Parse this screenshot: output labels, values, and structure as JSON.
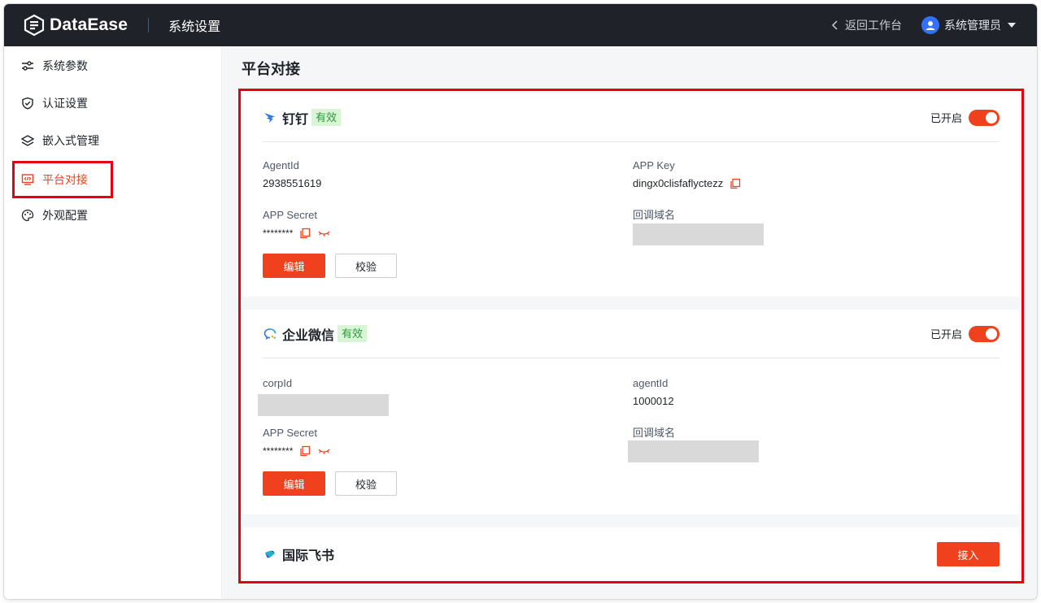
{
  "app": {
    "name": "DataEase",
    "section": "系统设置"
  },
  "header": {
    "back_label": "返回工作台",
    "user_name": "系统管理员"
  },
  "sidebar": {
    "items": [
      {
        "label": "系统参数",
        "icon": "sliders-icon"
      },
      {
        "label": "认证设置",
        "icon": "shield-icon"
      },
      {
        "label": "嵌入式管理",
        "icon": "layers-icon"
      },
      {
        "label": "平台对接",
        "icon": "monitor-code-icon",
        "active": true
      },
      {
        "label": "外观配置",
        "icon": "palette-icon"
      }
    ]
  },
  "page": {
    "title": "平台对接"
  },
  "dingtalk": {
    "name": "钉钉",
    "status": "有效",
    "switch_label": "已开启",
    "fields": {
      "agent_id_label": "AgentId",
      "agent_id_value": "2938551619",
      "app_key_label": "APP  Key",
      "app_key_value": "dingx0clisfaflyctezz",
      "app_secret_label": "APP  Secret",
      "app_secret_value": "********",
      "callback_label": "回调域名"
    },
    "edit_label": "编辑",
    "verify_label": "校验"
  },
  "wecom": {
    "name": "企业微信",
    "status": "有效",
    "switch_label": "已开启",
    "fields": {
      "corp_id_label": "corpId",
      "agent_id_label": "agentId",
      "agent_id_value": "1000012",
      "app_secret_label": "APP  Secret",
      "app_secret_value": "********",
      "callback_label": "回调域名"
    },
    "edit_label": "编辑",
    "verify_label": "校验"
  },
  "lark": {
    "name": "国际飞书",
    "connect_label": "接入"
  },
  "colors": {
    "accent": "#f0411e",
    "header_bg": "#1f2329",
    "valid_bg": "#d8f5d6",
    "valid_text": "#2b9a3e",
    "highlight": "#e60012"
  }
}
